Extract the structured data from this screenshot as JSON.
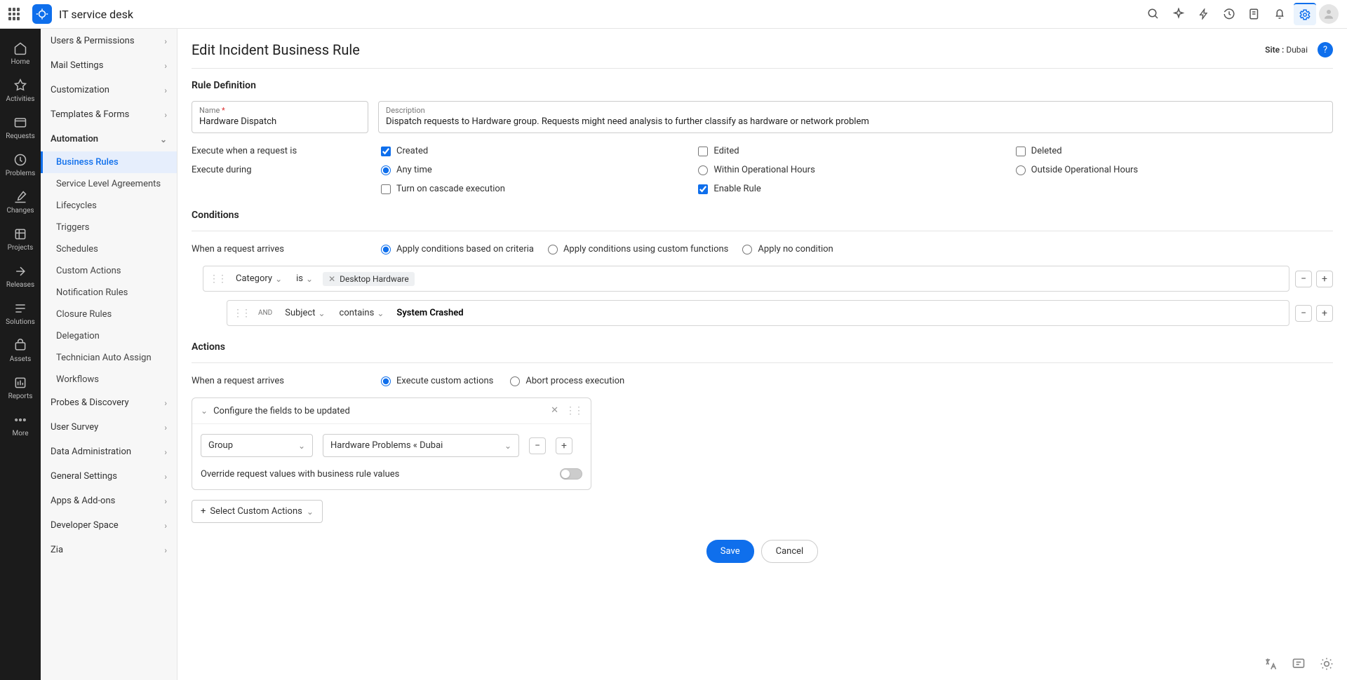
{
  "app_title": "IT service desk",
  "page_title": "Edit Incident Business Rule",
  "site": {
    "label": "Site :",
    "value": "Dubai"
  },
  "rail": [
    {
      "label": "Home"
    },
    {
      "label": "Activities"
    },
    {
      "label": "Requests"
    },
    {
      "label": "Problems"
    },
    {
      "label": "Changes"
    },
    {
      "label": "Projects"
    },
    {
      "label": "Releases"
    },
    {
      "label": "Solutions"
    },
    {
      "label": "Assets"
    },
    {
      "label": "Reports"
    },
    {
      "label": "More"
    }
  ],
  "sidebar": {
    "items": [
      {
        "label": "Users & Permissions"
      },
      {
        "label": "Mail Settings"
      },
      {
        "label": "Customization"
      },
      {
        "label": "Templates & Forms"
      },
      {
        "label": "Automation",
        "expanded": true,
        "children": [
          {
            "label": "Business Rules",
            "active": true
          },
          {
            "label": "Service Level Agreements"
          },
          {
            "label": "Lifecycles"
          },
          {
            "label": "Triggers"
          },
          {
            "label": "Schedules"
          },
          {
            "label": "Custom Actions"
          },
          {
            "label": "Notification Rules"
          },
          {
            "label": "Closure Rules"
          },
          {
            "label": "Delegation"
          },
          {
            "label": "Technician Auto Assign"
          },
          {
            "label": "Workflows"
          }
        ]
      },
      {
        "label": "Probes & Discovery"
      },
      {
        "label": "User Survey"
      },
      {
        "label": "Data Administration"
      },
      {
        "label": "General Settings"
      },
      {
        "label": "Apps & Add-ons"
      },
      {
        "label": "Developer Space"
      },
      {
        "label": "Zia"
      }
    ]
  },
  "sections": {
    "rule_def_title": "Rule Definition",
    "conditions_title": "Conditions",
    "actions_title": "Actions"
  },
  "fields": {
    "name_label": "Name",
    "name_value": "Hardware Dispatch",
    "desc_label": "Description",
    "desc_value": "Dispatch requests to Hardware group. Requests might need analysis to further classify as hardware or network problem"
  },
  "exec_when": {
    "label": "Execute when a request is",
    "created": "Created",
    "edited": "Edited",
    "deleted": "Deleted"
  },
  "exec_during": {
    "label": "Execute during",
    "any": "Any time",
    "within": "Within Operational Hours",
    "outside": "Outside Operational Hours"
  },
  "cascade": "Turn on cascade execution",
  "enable": "Enable Rule",
  "cond_when": "When a request arrives",
  "cond_options": {
    "criteria": "Apply conditions based on criteria",
    "custom": "Apply conditions using custom functions",
    "none": "Apply no condition"
  },
  "cond_rows": [
    {
      "field": "Category",
      "op": "is",
      "tag": "Desktop Hardware"
    },
    {
      "join": "AND",
      "field": "Subject",
      "op": "contains",
      "value": "System Crashed"
    }
  ],
  "act_when": "When a request arrives",
  "act_options": {
    "exec": "Execute custom actions",
    "abort": "Abort process execution"
  },
  "panel": {
    "title": "Configure the fields to be updated",
    "field": "Group",
    "value": "Hardware Problems « Dubai",
    "override": "Override request values with business rule values"
  },
  "select_custom": "Select Custom Actions",
  "buttons": {
    "save": "Save",
    "cancel": "Cancel"
  }
}
